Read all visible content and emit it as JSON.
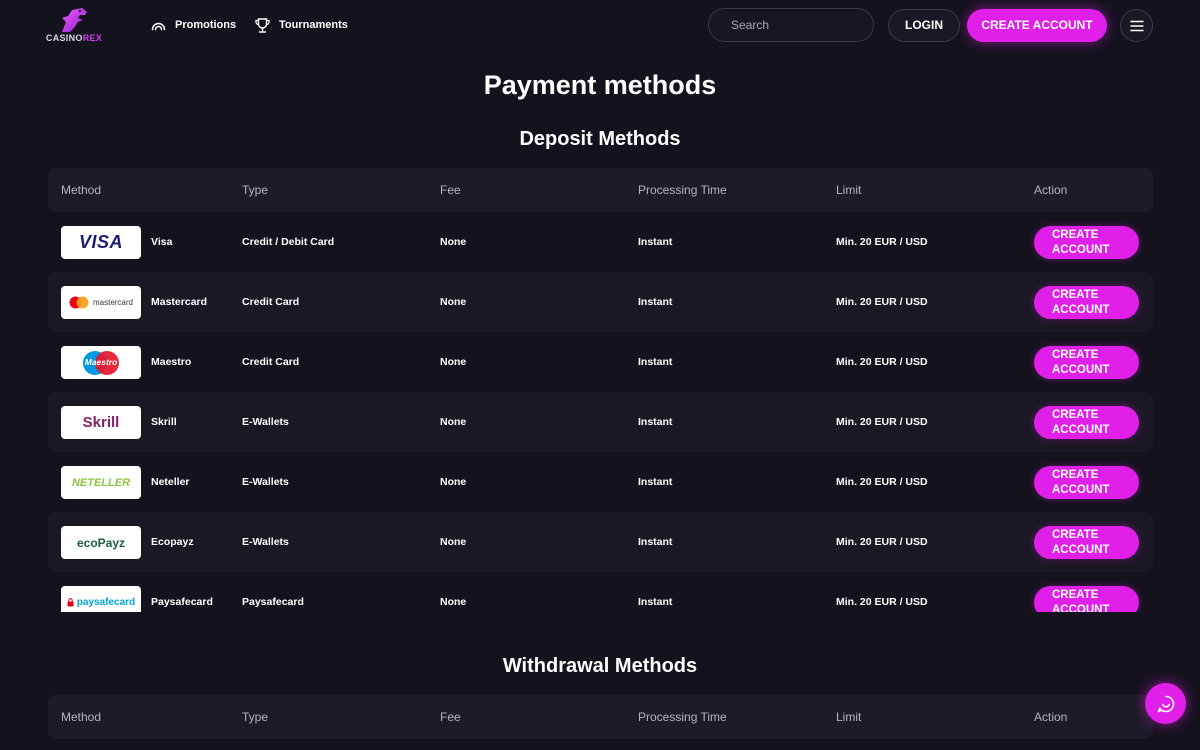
{
  "brand": {
    "logo_text_a": "CASINO",
    "logo_text_b": "REX"
  },
  "nav": [
    {
      "label": "Promotions",
      "icon": "gauge-icon"
    },
    {
      "label": "Tournaments",
      "icon": "trophy-icon"
    }
  ],
  "search": {
    "placeholder": "Search",
    "value": ""
  },
  "header": {
    "login_label": "LOGIN",
    "create_label": "CREATE ACCOUNT"
  },
  "page": {
    "title": "Payment methods"
  },
  "deposit": {
    "title": "Deposit Methods",
    "columns": [
      "Method",
      "Type",
      "Fee",
      "Processing Time",
      "Limit",
      "Action"
    ],
    "rows": [
      {
        "logo": "VISA",
        "method": "Visa",
        "type": "Credit / Debit Card",
        "fee": "None",
        "processing": "Instant",
        "limit": "Min. 20 EUR / USD",
        "action": "CREATE ACCOUNT"
      },
      {
        "logo": "mastercard",
        "method": "Mastercard",
        "type": "Credit Card",
        "fee": "None",
        "processing": "Instant",
        "limit": "Min. 20 EUR / USD",
        "action": "CREATE ACCOUNT"
      },
      {
        "logo": "Maestro",
        "method": "Maestro",
        "type": "Credit Card",
        "fee": "None",
        "processing": "Instant",
        "limit": "Min. 20 EUR / USD",
        "action": "CREATE ACCOUNT"
      },
      {
        "logo": "Skrill",
        "method": "Skrill",
        "type": "E-Wallets",
        "fee": "None",
        "processing": "Instant",
        "limit": "Min. 20 EUR / USD",
        "action": "CREATE ACCOUNT"
      },
      {
        "logo": "NETELLER",
        "method": "Neteller",
        "type": "E-Wallets",
        "fee": "None",
        "processing": "Instant",
        "limit": "Min. 20 EUR / USD",
        "action": "CREATE ACCOUNT"
      },
      {
        "logo": "ecoPayz",
        "method": "Ecopayz",
        "type": "E-Wallets",
        "fee": "None",
        "processing": "Instant",
        "limit": "Min. 20 EUR / USD",
        "action": "CREATE ACCOUNT"
      },
      {
        "logo": "paysafecard",
        "method": "Paysafecard",
        "type": "Paysafecard",
        "fee": "None",
        "processing": "Instant",
        "limit": "Min. 20 EUR / USD",
        "action": "CREATE ACCOUNT"
      }
    ]
  },
  "withdrawal": {
    "title": "Withdrawal Methods",
    "columns": [
      "Method",
      "Type",
      "Fee",
      "Processing Time",
      "Limit",
      "Action"
    ]
  },
  "colors": {
    "accent": "#e01fe9",
    "background": "#14121d",
    "row_alt": "#1a1823",
    "header_row": "#1d1b27"
  },
  "icons": {
    "search": "search-icon",
    "filter": "filter-icon",
    "menu": "hamburger-icon",
    "chat": "chat-icon"
  }
}
